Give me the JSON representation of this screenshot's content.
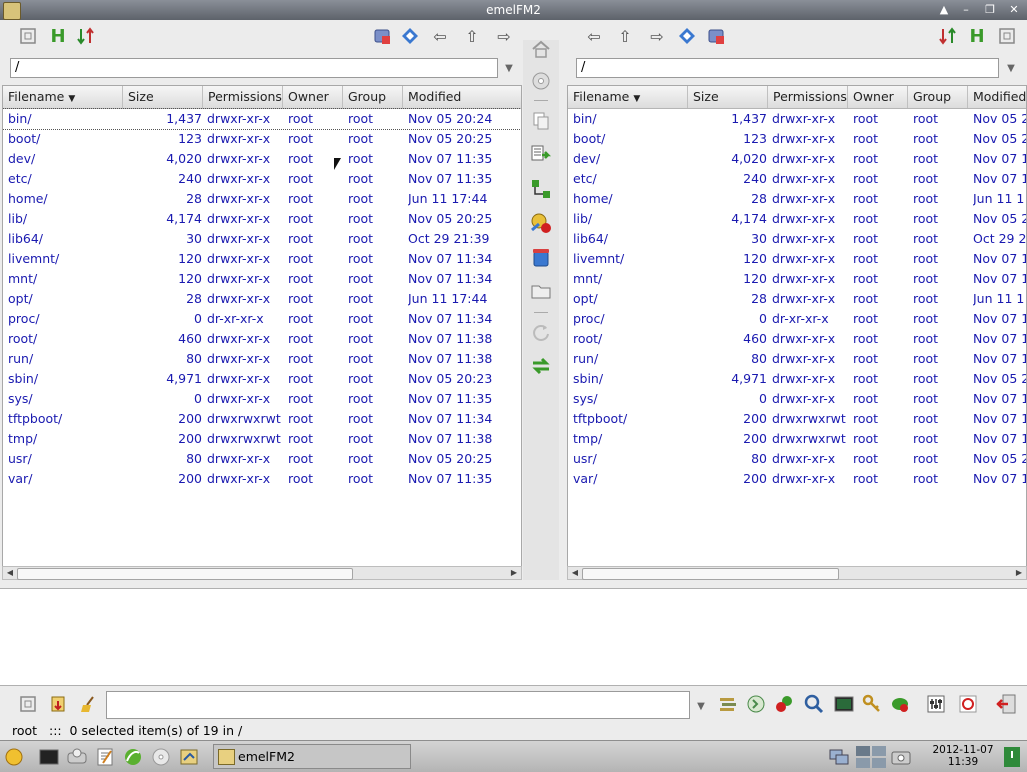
{
  "window": {
    "title": "emelFM2"
  },
  "left_pane": {
    "path": "/",
    "columns": [
      "Filename",
      "Size",
      "Permissions",
      "Owner",
      "Group",
      "Modified"
    ],
    "sort_indicator": "▼",
    "rows": [
      {
        "name": "bin/",
        "size": "1,437",
        "perm": "drwxr-xr-x",
        "owner": "root",
        "group": "root",
        "mod": "Nov 05 20:24"
      },
      {
        "name": "boot/",
        "size": "123",
        "perm": "drwxr-xr-x",
        "owner": "root",
        "group": "root",
        "mod": "Nov 05 20:25"
      },
      {
        "name": "dev/",
        "size": "4,020",
        "perm": "drwxr-xr-x",
        "owner": "root",
        "group": "root",
        "mod": "Nov 07 11:35"
      },
      {
        "name": "etc/",
        "size": "240",
        "perm": "drwxr-xr-x",
        "owner": "root",
        "group": "root",
        "mod": "Nov 07 11:35"
      },
      {
        "name": "home/",
        "size": "28",
        "perm": "drwxr-xr-x",
        "owner": "root",
        "group": "root",
        "mod": "Jun 11 17:44"
      },
      {
        "name": "lib/",
        "size": "4,174",
        "perm": "drwxr-xr-x",
        "owner": "root",
        "group": "root",
        "mod": "Nov 05 20:25"
      },
      {
        "name": "lib64/",
        "size": "30",
        "perm": "drwxr-xr-x",
        "owner": "root",
        "group": "root",
        "mod": "Oct 29 21:39"
      },
      {
        "name": "livemnt/",
        "size": "120",
        "perm": "drwxr-xr-x",
        "owner": "root",
        "group": "root",
        "mod": "Nov 07 11:34"
      },
      {
        "name": "mnt/",
        "size": "120",
        "perm": "drwxr-xr-x",
        "owner": "root",
        "group": "root",
        "mod": "Nov 07 11:34"
      },
      {
        "name": "opt/",
        "size": "28",
        "perm": "drwxr-xr-x",
        "owner": "root",
        "group": "root",
        "mod": "Jun 11 17:44"
      },
      {
        "name": "proc/",
        "size": "0",
        "perm": "dr-xr-xr-x",
        "owner": "root",
        "group": "root",
        "mod": "Nov 07 11:34"
      },
      {
        "name": "root/",
        "size": "460",
        "perm": "drwxr-xr-x",
        "owner": "root",
        "group": "root",
        "mod": "Nov 07 11:38"
      },
      {
        "name": "run/",
        "size": "80",
        "perm": "drwxr-xr-x",
        "owner": "root",
        "group": "root",
        "mod": "Nov 07 11:38"
      },
      {
        "name": "sbin/",
        "size": "4,971",
        "perm": "drwxr-xr-x",
        "owner": "root",
        "group": "root",
        "mod": "Nov 05 20:23"
      },
      {
        "name": "sys/",
        "size": "0",
        "perm": "drwxr-xr-x",
        "owner": "root",
        "group": "root",
        "mod": "Nov 07 11:35"
      },
      {
        "name": "tftpboot/",
        "size": "200",
        "perm": "drwxrwxrwt",
        "owner": "root",
        "group": "root",
        "mod": "Nov 07 11:34"
      },
      {
        "name": "tmp/",
        "size": "200",
        "perm": "drwxrwxrwt",
        "owner": "root",
        "group": "root",
        "mod": "Nov 07 11:38"
      },
      {
        "name": "usr/",
        "size": "80",
        "perm": "drwxr-xr-x",
        "owner": "root",
        "group": "root",
        "mod": "Nov 05 20:25"
      },
      {
        "name": "var/",
        "size": "200",
        "perm": "drwxr-xr-x",
        "owner": "root",
        "group": "root",
        "mod": "Nov 07 11:35"
      }
    ]
  },
  "right_pane": {
    "path": "/",
    "columns": [
      "Filename",
      "Size",
      "Permissions",
      "Owner",
      "Group",
      "Modified"
    ],
    "sort_indicator": "▼",
    "rows": [
      {
        "name": "bin/",
        "size": "1,437",
        "perm": "drwxr-xr-x",
        "owner": "root",
        "group": "root",
        "mod": "Nov 05 2"
      },
      {
        "name": "boot/",
        "size": "123",
        "perm": "drwxr-xr-x",
        "owner": "root",
        "group": "root",
        "mod": "Nov 05 2"
      },
      {
        "name": "dev/",
        "size": "4,020",
        "perm": "drwxr-xr-x",
        "owner": "root",
        "group": "root",
        "mod": "Nov 07 1"
      },
      {
        "name": "etc/",
        "size": "240",
        "perm": "drwxr-xr-x",
        "owner": "root",
        "group": "root",
        "mod": "Nov 07 1"
      },
      {
        "name": "home/",
        "size": "28",
        "perm": "drwxr-xr-x",
        "owner": "root",
        "group": "root",
        "mod": "Jun 11 1"
      },
      {
        "name": "lib/",
        "size": "4,174",
        "perm": "drwxr-xr-x",
        "owner": "root",
        "group": "root",
        "mod": "Nov 05 2"
      },
      {
        "name": "lib64/",
        "size": "30",
        "perm": "drwxr-xr-x",
        "owner": "root",
        "group": "root",
        "mod": "Oct 29 2"
      },
      {
        "name": "livemnt/",
        "size": "120",
        "perm": "drwxr-xr-x",
        "owner": "root",
        "group": "root",
        "mod": "Nov 07 1"
      },
      {
        "name": "mnt/",
        "size": "120",
        "perm": "drwxr-xr-x",
        "owner": "root",
        "group": "root",
        "mod": "Nov 07 1"
      },
      {
        "name": "opt/",
        "size": "28",
        "perm": "drwxr-xr-x",
        "owner": "root",
        "group": "root",
        "mod": "Jun 11 1"
      },
      {
        "name": "proc/",
        "size": "0",
        "perm": "dr-xr-xr-x",
        "owner": "root",
        "group": "root",
        "mod": "Nov 07 1"
      },
      {
        "name": "root/",
        "size": "460",
        "perm": "drwxr-xr-x",
        "owner": "root",
        "group": "root",
        "mod": "Nov 07 1"
      },
      {
        "name": "run/",
        "size": "80",
        "perm": "drwxr-xr-x",
        "owner": "root",
        "group": "root",
        "mod": "Nov 07 1"
      },
      {
        "name": "sbin/",
        "size": "4,971",
        "perm": "drwxr-xr-x",
        "owner": "root",
        "group": "root",
        "mod": "Nov 05 2"
      },
      {
        "name": "sys/",
        "size": "0",
        "perm": "drwxr-xr-x",
        "owner": "root",
        "group": "root",
        "mod": "Nov 07 1"
      },
      {
        "name": "tftpboot/",
        "size": "200",
        "perm": "drwxrwxrwt",
        "owner": "root",
        "group": "root",
        "mod": "Nov 07 1"
      },
      {
        "name": "tmp/",
        "size": "200",
        "perm": "drwxrwxrwt",
        "owner": "root",
        "group": "root",
        "mod": "Nov 07 1"
      },
      {
        "name": "usr/",
        "size": "80",
        "perm": "drwxr-xr-x",
        "owner": "root",
        "group": "root",
        "mod": "Nov 05 2"
      },
      {
        "name": "var/",
        "size": "200",
        "perm": "drwxr-xr-x",
        "owner": "root",
        "group": "root",
        "mod": "Nov 07 1"
      }
    ]
  },
  "status": {
    "text": "root   :::  0 selected item(s) of 19 in /"
  },
  "taskbar": {
    "task_label": "emelFM2",
    "clock_date": "2012-11-07",
    "clock_time": "11:39"
  },
  "colors": {
    "link_blue": "#1a1ab0",
    "accent_green": "#3a9a2a",
    "accent_blue": "#2f6fd0"
  }
}
